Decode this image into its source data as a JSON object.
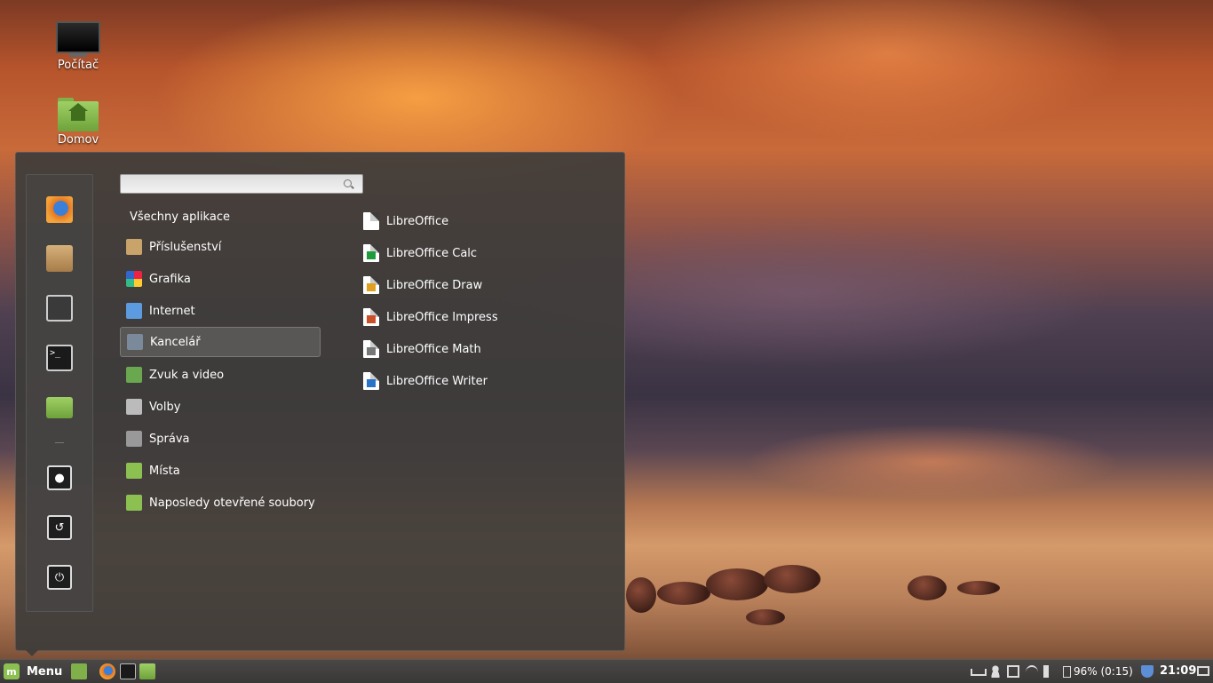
{
  "desktop": {
    "icons": [
      {
        "label": "Počítač",
        "icon": "computer-icon"
      },
      {
        "label": "Domov",
        "icon": "home-folder-icon"
      }
    ]
  },
  "menu": {
    "search": {
      "value": "",
      "placeholder": ""
    },
    "all_apps_label": "Všechny aplikace",
    "favorites": [
      "firefox-icon",
      "package-manager-icon",
      "system-settings-icon",
      "terminal-icon",
      "files-folder-icon"
    ],
    "session_buttons": [
      "lock-screen-icon",
      "logout-icon",
      "shutdown-icon"
    ],
    "categories": [
      {
        "label": "Příslušenství",
        "icon": "accessories-icon",
        "color": "#c9a46a"
      },
      {
        "label": "Grafika",
        "icon": "graphics-icon",
        "color": "#d94a8c"
      },
      {
        "label": "Internet",
        "icon": "internet-icon",
        "color": "#5d9be0"
      },
      {
        "label": "Kancelář",
        "icon": "office-icon",
        "color": "#7a8a9a",
        "selected": true
      },
      {
        "label": "Zvuk a video",
        "icon": "multimedia-icon",
        "color": "#6aa84f"
      },
      {
        "label": "Volby",
        "icon": "preferences-icon",
        "color": "#bbbbbb"
      },
      {
        "label": "Správa",
        "icon": "administration-icon",
        "color": "#999999"
      },
      {
        "label": "Místa",
        "icon": "places-folder-icon",
        "color": "#8cc152"
      },
      {
        "label": "Naposledy otevřené soubory",
        "icon": "recent-files-icon",
        "color": "#8cc152"
      }
    ],
    "apps": [
      {
        "label": "LibreOffice",
        "icon": "libreoffice-icon",
        "color": "#888888"
      },
      {
        "label": "LibreOffice Calc",
        "icon": "libreoffice-calc-icon",
        "color": "#1e9c3c"
      },
      {
        "label": "LibreOffice Draw",
        "icon": "libreoffice-draw-icon",
        "color": "#e0a020"
      },
      {
        "label": "LibreOffice Impress",
        "icon": "libreoffice-impress-icon",
        "color": "#c8512a"
      },
      {
        "label": "LibreOffice Math",
        "icon": "libreoffice-math-icon",
        "color": "#777777"
      },
      {
        "label": "LibreOffice Writer",
        "icon": "libreoffice-writer-icon",
        "color": "#2a74c8"
      }
    ]
  },
  "taskbar": {
    "menu_label": "Menu",
    "battery": "96% (0:15)",
    "clock": "21:09"
  }
}
